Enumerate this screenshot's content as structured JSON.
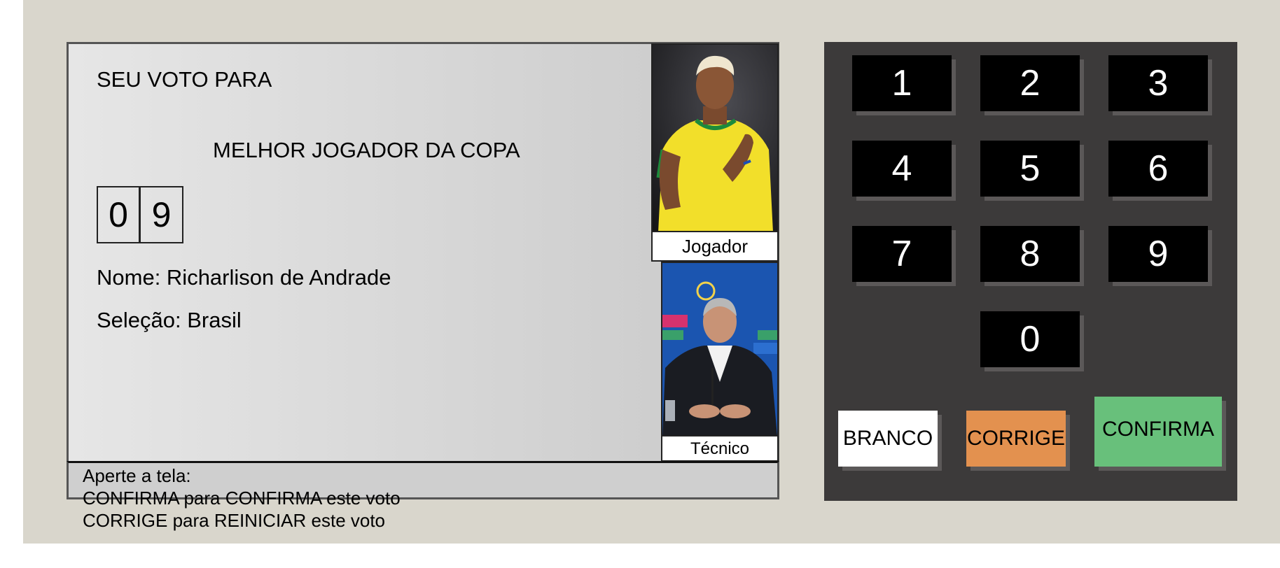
{
  "screen": {
    "title": "SEU VOTO PARA",
    "office": "MELHOR JOGADOR DA COPA",
    "digits": [
      "0",
      "9"
    ],
    "name_line": "Nome: Richarlison de Andrade",
    "team_line": "Seleção: Brasil",
    "player_caption": "Jogador",
    "coach_caption": "Técnico",
    "instructions": [
      "Aperte a tela:",
      "CONFIRMA para CONFIRMA este voto",
      "CORRIGE para REINICIAR este voto"
    ]
  },
  "keypad": {
    "keys": [
      "1",
      "2",
      "3",
      "4",
      "5",
      "6",
      "7",
      "8",
      "9",
      "0"
    ],
    "branco_label": "BRANCO",
    "corrige_label": "CORRIGE",
    "confirma_label": "CONFIRMA"
  },
  "colors": {
    "machine_bg": "#d9d6cc",
    "keypad_bg": "#3c3a3a",
    "corrige": "#e3914f",
    "confirma": "#68c07b",
    "branco": "#ffffff"
  }
}
